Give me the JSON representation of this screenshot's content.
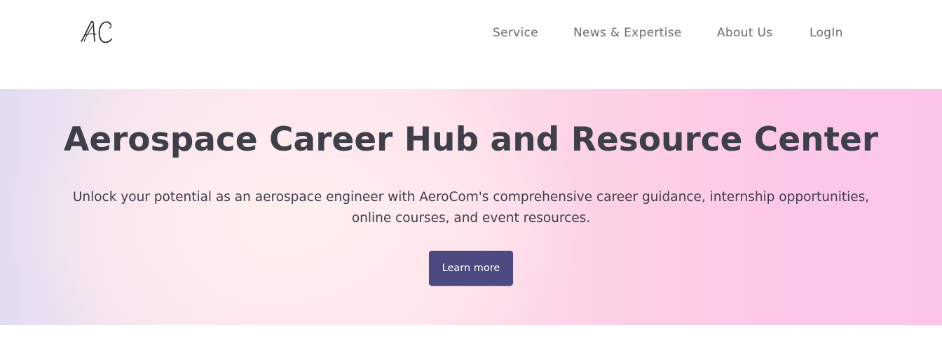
{
  "header": {
    "logo_icon": "ac-monogram-logo",
    "nav": [
      {
        "label": "Service"
      },
      {
        "label": "News & Expertise"
      },
      {
        "label": "About Us"
      },
      {
        "label": "LogIn"
      }
    ]
  },
  "hero": {
    "title": "Aerospace Career Hub and Resource Center",
    "subtitle": "Unlock your potential as an aerospace engineer with AeroCom's comprehensive career guidance, internship opportunities, online courses, and event resources.",
    "cta_label": "Learn more"
  },
  "colors": {
    "title_text": "#3d3f4a",
    "nav_text": "#6b6b72",
    "cta_background": "#4d4a82",
    "hero_gradient_start": "#e2dcf2",
    "hero_gradient_end": "#fbc6ea"
  }
}
